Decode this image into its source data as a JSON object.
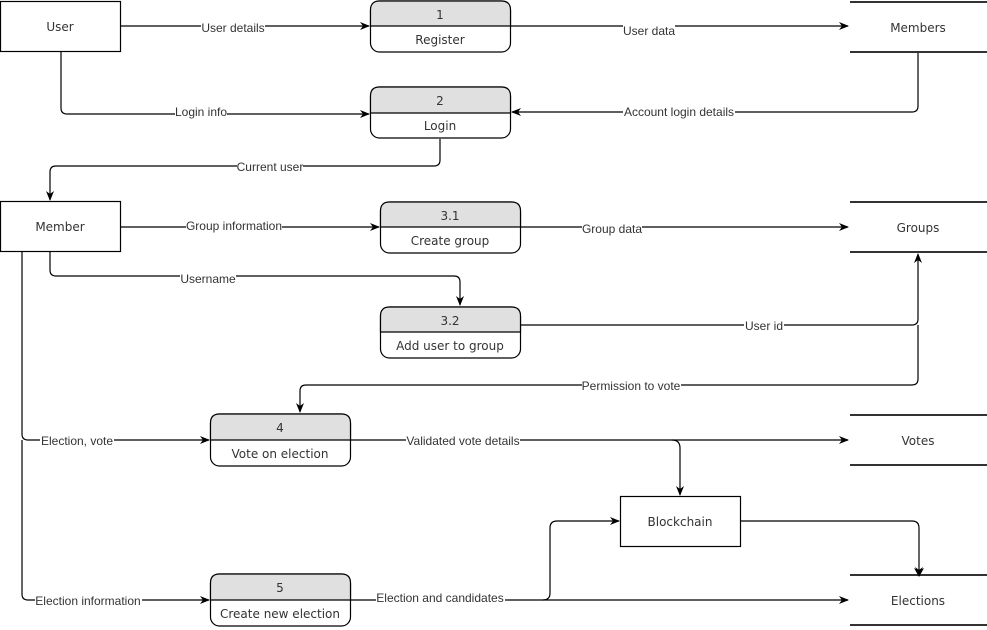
{
  "diagram": {
    "type": "data-flow-diagram",
    "entities": [
      {
        "id": "user",
        "label": "User"
      },
      {
        "id": "member",
        "label": "Member"
      },
      {
        "id": "blockchain",
        "label": "Blockchain"
      }
    ],
    "processes": [
      {
        "id": "p1",
        "number": "1",
        "label": "Register"
      },
      {
        "id": "p2",
        "number": "2",
        "label": "Login"
      },
      {
        "id": "p31",
        "number": "3.1",
        "label": "Create group"
      },
      {
        "id": "p32",
        "number": "3.2",
        "label": "Add user to group"
      },
      {
        "id": "p4",
        "number": "4",
        "label": "Vote on election"
      },
      {
        "id": "p5",
        "number": "5",
        "label": "Create new election"
      }
    ],
    "stores": [
      {
        "id": "members",
        "label": "Members"
      },
      {
        "id": "groups",
        "label": "Groups"
      },
      {
        "id": "votes",
        "label": "Votes"
      },
      {
        "id": "elections",
        "label": "Elections"
      }
    ],
    "flows": [
      {
        "from": "user",
        "to": "p1",
        "label": "User details"
      },
      {
        "from": "p1",
        "to": "members",
        "label": "User data"
      },
      {
        "from": "user",
        "to": "p2",
        "label": "Login info"
      },
      {
        "from": "members",
        "to": "p2",
        "label": "Account login details"
      },
      {
        "from": "p2",
        "to": "member",
        "label": "Current user"
      },
      {
        "from": "member",
        "to": "p31",
        "label": "Group information"
      },
      {
        "from": "p31",
        "to": "groups",
        "label": "Group data"
      },
      {
        "from": "member",
        "to": "p32",
        "label": "Username"
      },
      {
        "from": "p32",
        "to": "groups",
        "label": "User id"
      },
      {
        "from": "groups",
        "to": "p4",
        "label": "Permission to vote"
      },
      {
        "from": "member",
        "to": "p4",
        "label": "Election, vote"
      },
      {
        "from": "p4",
        "to": "votes",
        "label": "Validated vote details"
      },
      {
        "from": "p4",
        "to": "blockchain",
        "label": ""
      },
      {
        "from": "member",
        "to": "p5",
        "label": "Election information"
      },
      {
        "from": "p5",
        "to": "elections",
        "label": "Election and candidates"
      },
      {
        "from": "p5",
        "to": "blockchain",
        "label": ""
      },
      {
        "from": "blockchain",
        "to": "elections",
        "label": ""
      }
    ]
  }
}
